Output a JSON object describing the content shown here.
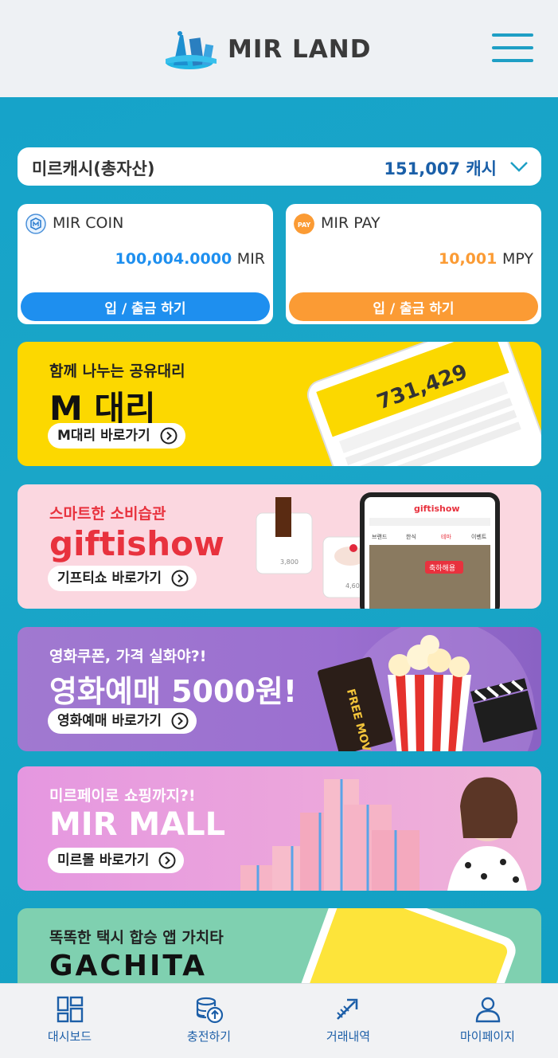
{
  "header": {
    "brand": "MIR LAND",
    "menu_icon": "hamburger-icon"
  },
  "total": {
    "label": "미르캐시(총자산)",
    "value": "151,007 캐시"
  },
  "wallets": [
    {
      "title": "MIR COIN",
      "amount": "100,004.0000",
      "unit": "MIR",
      "button": "입 / 출금 하기",
      "accent": "#1e8fef",
      "amount_color": "#1e8fef"
    },
    {
      "title": "MIR PAY",
      "amount": "10,001",
      "unit": "MPY",
      "button": "입 / 출금 하기",
      "accent": "#fb9b34",
      "amount_color": "#fb9b34"
    }
  ],
  "banners": [
    {
      "sub": "함께 나누는 공유대리",
      "title": "M 대리",
      "button": "M대리 바로가기",
      "phone_value": "731,429"
    },
    {
      "sub": "스마트한 소비습관",
      "title": "giftishow",
      "button": "기프티쇼 바로가기",
      "phone_brand": "giftishow",
      "tabs": [
        "브랜드",
        "한식",
        "테마",
        "이벤트"
      ],
      "badge": "축하해용",
      "price1": "3,800",
      "price2": "4,600"
    },
    {
      "sub": "영화쿠폰, 가격 실화야?!",
      "title": "영화예매 5000원!",
      "button": "영화예매 바로가기",
      "ticket": "FREE MOVIE"
    },
    {
      "sub": "미르페이로 쇼핑까지?!",
      "title": "MIR MALL",
      "button": "미르몰 바로가기"
    },
    {
      "sub": "똑똑한 택시 합승 앱 가치타",
      "title": "GACHITA"
    }
  ],
  "nav": [
    {
      "label": "대시보드",
      "icon": "dashboard-icon"
    },
    {
      "label": "충전하기",
      "icon": "charge-coins-icon"
    },
    {
      "label": "거래내역",
      "icon": "transaction-arrows-icon"
    },
    {
      "label": "마이페이지",
      "icon": "user-icon"
    }
  ],
  "colors": {
    "brand_blue": "#1ba3c6",
    "nav_blue": "#1d5fa8",
    "header_bg": "#eef1f4"
  }
}
